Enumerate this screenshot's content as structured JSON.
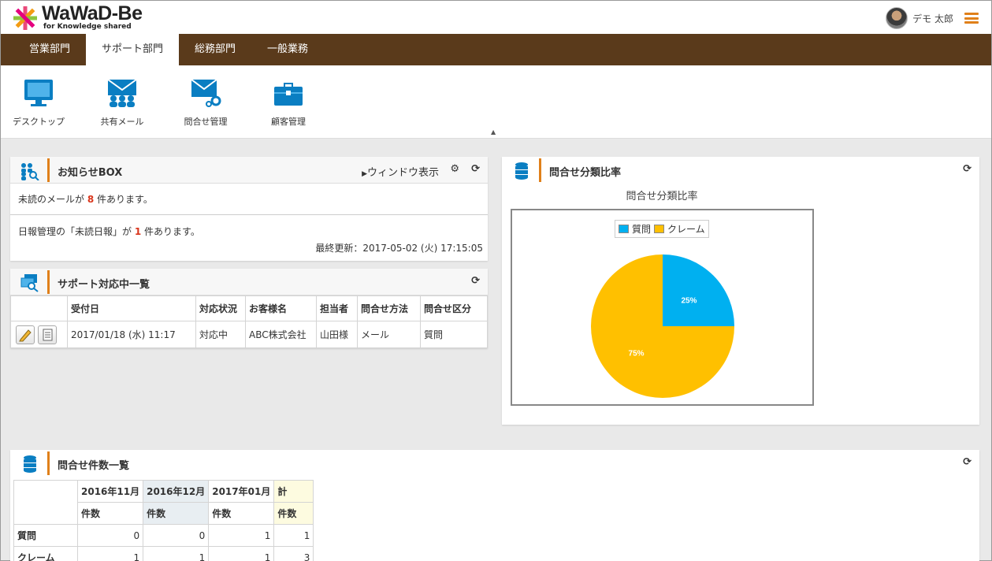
{
  "app": {
    "logo_name": "WaWaD-Be",
    "logo_tagline": "for Knowledge shared"
  },
  "user": {
    "name": "デモ 太郎"
  },
  "nav": {
    "tabs": [
      {
        "label": "営業部門",
        "active": false
      },
      {
        "label": "サポート部門",
        "active": true
      },
      {
        "label": "総務部門",
        "active": false
      },
      {
        "label": "一般業務",
        "active": false
      }
    ]
  },
  "toolbar": {
    "items": [
      {
        "label": "デスクトップ",
        "icon": "monitor-icon"
      },
      {
        "label": "共有メール",
        "icon": "shared-mail-icon"
      },
      {
        "label": "問合せ管理",
        "icon": "inquiry-mail-gear-icon"
      },
      {
        "label": "顧客管理",
        "icon": "toolbox-icon"
      }
    ]
  },
  "notice": {
    "title": "お知らせBOX",
    "window_link": "ウィンドウ表示",
    "mail_prefix": "未読のメールが",
    "mail_count": "8",
    "mail_suffix": "件あります。",
    "report_prefix": "日報管理の「未読日報」が",
    "report_count": "1",
    "report_suffix": "件あります。",
    "updated": "最終更新：2017-05-02 (火) 17:15:05"
  },
  "support": {
    "title": "サポート対応中一覧",
    "headers": [
      "受付日",
      "対応状況",
      "お客様名",
      "担当者",
      "問合せ方法",
      "問合せ区分"
    ],
    "rows": [
      {
        "date": "2017/01/18 (水) 11:17",
        "status": "対応中",
        "customer": "ABC株式会社",
        "staff": "山田様",
        "method": "メール",
        "category": "質問"
      }
    ]
  },
  "ratio": {
    "title": "問合せ分類比率",
    "chart_title": "問合せ分類比率"
  },
  "chart_data": {
    "type": "pie",
    "title": "問合せ分類比率",
    "categories": [
      "質問",
      "クレーム"
    ],
    "values": [
      25,
      75
    ],
    "labels": [
      "25%",
      "75%"
    ],
    "colors": [
      "#00b0f0",
      "#ffc000"
    ],
    "legend": "top"
  },
  "counts": {
    "title": "問合せ件数一覧",
    "months": [
      "2016年11月",
      "2016年12月",
      "2017年01月",
      "計"
    ],
    "sub_header": "件数",
    "rows": [
      {
        "label": "質問",
        "values": [
          "0",
          "0",
          "1",
          "1"
        ]
      },
      {
        "label": "クレーム",
        "values": [
          "1",
          "1",
          "1",
          "3"
        ]
      }
    ]
  }
}
